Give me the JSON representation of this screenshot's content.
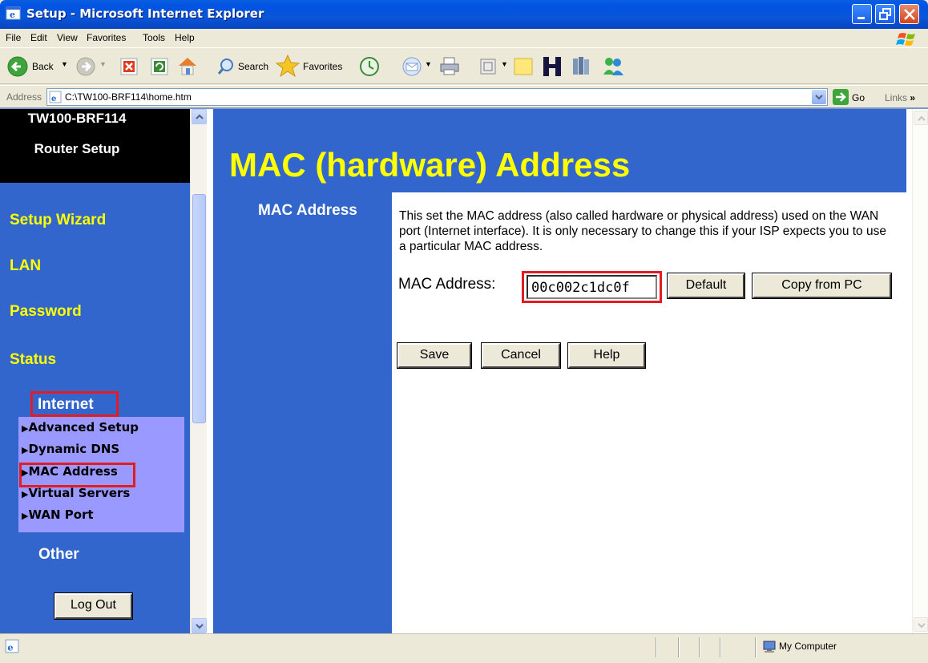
{
  "window": {
    "title": "Setup - Microsoft Internet Explorer"
  },
  "menu": {
    "items": [
      "File",
      "Edit",
      "View",
      "Favorites",
      "Tools",
      "Help"
    ]
  },
  "toolbar": {
    "back_label": "Back",
    "search_label": "Search",
    "favorites_label": "Favorites"
  },
  "address": {
    "label": "Address",
    "url": "C:\\TW100-BRF114\\home.htm",
    "go_label": "Go",
    "links_label": "Links"
  },
  "sidebar": {
    "header_line1": "TW100-BRF114",
    "header_line2": "Router Setup",
    "links": [
      "Setup Wizard",
      "LAN",
      "Password",
      "Status"
    ],
    "internet_label": "Internet",
    "submenu": [
      "Advanced Setup",
      "Dynamic DNS",
      "MAC Address",
      "Virtual Servers",
      "WAN Port"
    ],
    "other_label": "Other",
    "logout_label": "Log Out"
  },
  "main": {
    "title": "MAC (hardware) Address",
    "section_label": "MAC Address",
    "description": "This set the MAC address (also called hardware or physical address) used on the WAN port (Internet interface). It is only necessary to change this if your ISP expects you to use a particular MAC address.",
    "mac_label": "MAC Address:",
    "mac_value": "00c002c1dc0f",
    "default_label": "Default",
    "copy_label": "Copy from PC",
    "save_label": "Save",
    "cancel_label": "Cancel",
    "help_label": "Help"
  },
  "status": {
    "zone": "My Computer"
  },
  "colors": {
    "frame_blue": "#3366cc",
    "nav_yellow": "#ffff00",
    "submenu_bg": "#9999ff",
    "highlight_red": "#e31b23"
  }
}
